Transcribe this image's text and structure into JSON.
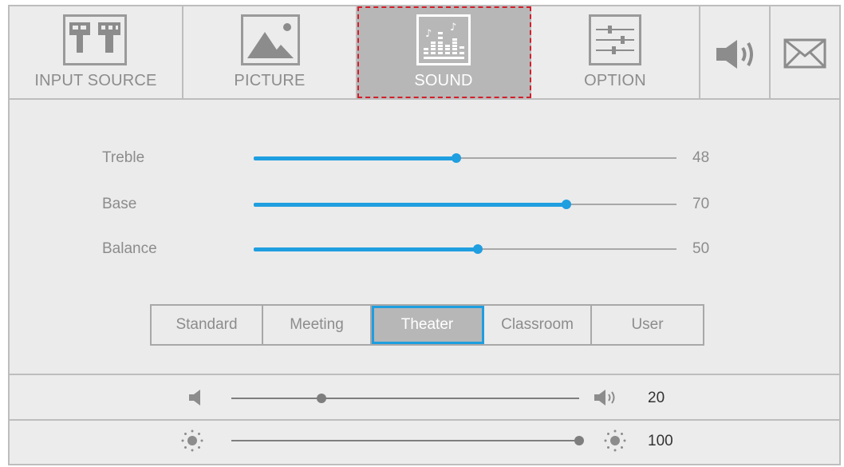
{
  "tabs": [
    {
      "label": "INPUT SOURCE",
      "icon": "input-source-icon",
      "active": false
    },
    {
      "label": "PICTURE",
      "icon": "picture-icon",
      "active": false
    },
    {
      "label": "SOUND",
      "icon": "sound-equalizer-icon",
      "active": true
    },
    {
      "label": "OPTION",
      "icon": "option-sliders-icon",
      "active": false
    },
    {
      "label": "",
      "icon": "speaker-icon",
      "active": false
    },
    {
      "label": "",
      "icon": "mail-icon",
      "active": false
    }
  ],
  "sound": {
    "treble": {
      "label": "Treble",
      "value": "48",
      "level": 0.48
    },
    "base": {
      "label": "Base",
      "value": "70",
      "level": 0.74
    },
    "balance": {
      "label": "Balance",
      "value": "50",
      "level": 0.53
    }
  },
  "modes": {
    "items": [
      "Standard",
      "Meeting",
      "Theater",
      "Classroom",
      "User"
    ],
    "selected": "Theater"
  },
  "volume": {
    "value": "20",
    "level": 0.26,
    "icon_low": "speaker-mute-icon",
    "icon_high": "speaker-loud-icon"
  },
  "brightness": {
    "value": "100",
    "level": 1.0,
    "icon": "brightness-icon"
  },
  "colors": {
    "accent": "#1f9ee0",
    "active_tab_border": "#d21f2b",
    "panel": "#ebebeb",
    "gray_text": "#8c8c8c"
  }
}
